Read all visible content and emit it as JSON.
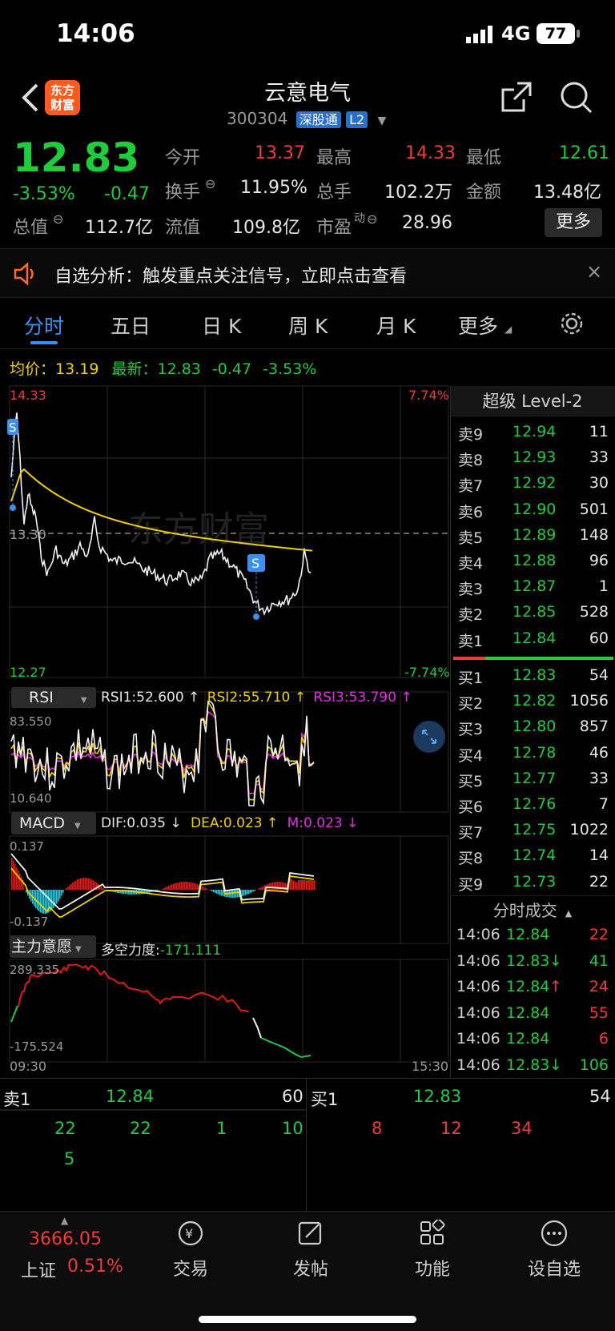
{
  "status": {
    "time": "14:06",
    "network": "4G",
    "battery": "77"
  },
  "header": {
    "name": "云意电气",
    "code": "300304",
    "badge_connect": "深股通",
    "badge_level": "L2",
    "logo_line1": "东方",
    "logo_line2": "财富"
  },
  "quote": {
    "price": "12.83",
    "change_pct": "-3.53%",
    "change": "-0.47",
    "open_label": "今开",
    "open": "13.37",
    "high_label": "最高",
    "high": "14.33",
    "low_label": "最低",
    "low": "12.61",
    "turnover_label": "换手",
    "turnover": "11.95%",
    "volume_label": "总手",
    "volume": "102.2万",
    "amount_label": "金额",
    "amount": "13.48亿",
    "mcap_label": "总值",
    "mcap": "112.7亿",
    "float_label": "流值",
    "float": "109.8亿",
    "pe_label": "市盈",
    "pe_sup": "动",
    "pe": "28.96",
    "more_label": "更多"
  },
  "alert": {
    "text": "自选分析：触发重点关注信号，立即点击查看"
  },
  "tabs": [
    "分时",
    "五日",
    "日 K",
    "周 K",
    "月 K",
    "更多"
  ],
  "intraday": {
    "avg_label": "均价：",
    "avg": "13.19",
    "last_label": "最新：",
    "last": "12.83",
    "last_chg": "-0.47",
    "last_pct": "-3.53%",
    "top_price": "14.33",
    "top_pct": "7.74%",
    "mid_price": "13.30",
    "bottom_price": "12.27",
    "bottom_pct": "-7.74%",
    "start_time": "09:30",
    "end_time": "15:30",
    "watermark": "东方财富",
    "signal": "S"
  },
  "rsi": {
    "name": "RSI",
    "rsi1": "RSI1:52.600 ↑",
    "rsi2": "RSI2:55.710 ↑",
    "rsi3": "RSI3:53.790 ↑",
    "top": "83.550",
    "bottom": "10.640"
  },
  "macd": {
    "name": "MACD",
    "dif": "DIF:0.035 ↓",
    "dea": "DEA:0.023 ↑",
    "m": "M:0.023 ↓",
    "top": "0.137",
    "bottom": "-0.137"
  },
  "main": {
    "name": "主力意愿",
    "label": "多空力度:",
    "value": "-171.111",
    "top": "289.335",
    "bottom": "-175.524"
  },
  "level2": {
    "title": "超级 Level-2",
    "asks": [
      {
        "label": "卖9",
        "price": "12.94",
        "vol": "11"
      },
      {
        "label": "卖8",
        "price": "12.93",
        "vol": "33"
      },
      {
        "label": "卖7",
        "price": "12.92",
        "vol": "30"
      },
      {
        "label": "卖6",
        "price": "12.90",
        "vol": "501"
      },
      {
        "label": "卖5",
        "price": "12.89",
        "vol": "148"
      },
      {
        "label": "卖4",
        "price": "12.88",
        "vol": "96"
      },
      {
        "label": "卖3",
        "price": "12.87",
        "vol": "1"
      },
      {
        "label": "卖2",
        "price": "12.85",
        "vol": "528"
      },
      {
        "label": "卖1",
        "price": "12.84",
        "vol": "60"
      }
    ],
    "bids": [
      {
        "label": "买1",
        "price": "12.83",
        "vol": "54"
      },
      {
        "label": "买2",
        "price": "12.82",
        "vol": "1056"
      },
      {
        "label": "买3",
        "price": "12.80",
        "vol": "857"
      },
      {
        "label": "买4",
        "price": "12.78",
        "vol": "46"
      },
      {
        "label": "买5",
        "price": "12.77",
        "vol": "33"
      },
      {
        "label": "买6",
        "price": "12.76",
        "vol": "7"
      },
      {
        "label": "买7",
        "price": "12.75",
        "vol": "1022"
      },
      {
        "label": "买8",
        "price": "12.74",
        "vol": "14"
      },
      {
        "label": "买9",
        "price": "12.73",
        "vol": "22"
      }
    ],
    "ticks_title": "分时成交",
    "ticks": [
      {
        "time": "14:06",
        "price": "12.84",
        "arrow": "",
        "vol": "22",
        "dir": "red"
      },
      {
        "time": "14:06",
        "price": "12.83",
        "arrow": "↓",
        "vol": "41",
        "dir": "green"
      },
      {
        "time": "14:06",
        "price": "12.84",
        "arrow": "↑",
        "vol": "24",
        "dir": "red"
      },
      {
        "time": "14:06",
        "price": "12.84",
        "arrow": "",
        "vol": "55",
        "dir": "red"
      },
      {
        "time": "14:06",
        "price": "12.84",
        "arrow": "",
        "vol": "6",
        "dir": "red"
      },
      {
        "time": "14:06",
        "price": "12.83",
        "arrow": "↓",
        "vol": "106",
        "dir": "green"
      }
    ]
  },
  "strip": {
    "ask_label": "卖1",
    "ask_price": "12.84",
    "ask_vol": "60",
    "bid_label": "买1",
    "bid_price": "12.83",
    "bid_vol": "54",
    "ask_queue": [
      "22",
      "22",
      "1",
      "10",
      "5"
    ],
    "bid_queue": [
      "8",
      "12",
      "34"
    ]
  },
  "tabbar": {
    "index_value": "3666.05",
    "index_name": "上证",
    "index_pct": "0.51%",
    "items": [
      "交易",
      "发帖",
      "功能",
      "设自选"
    ]
  },
  "colors": {
    "up": "#ef3b3b",
    "down": "#1fcc3b",
    "avg": "#f0d000",
    "accent": "#3a7bd5"
  }
}
